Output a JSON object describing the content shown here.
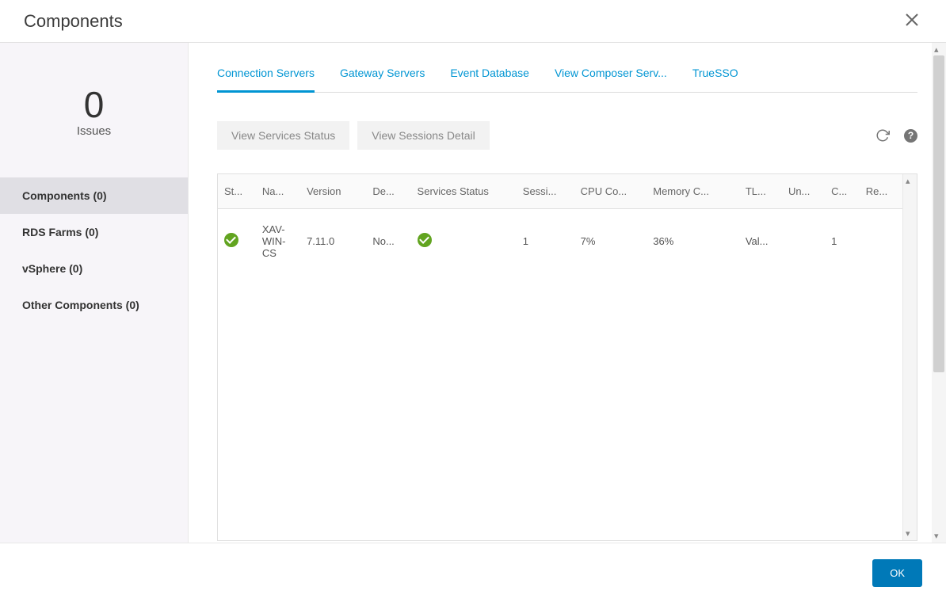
{
  "header": {
    "title": "Components"
  },
  "sidebar": {
    "issues_count": "0",
    "issues_label": "Issues",
    "items": [
      {
        "label": "Components (0)",
        "active": true
      },
      {
        "label": "RDS Farms (0)",
        "active": false
      },
      {
        "label": "vSphere (0)",
        "active": false
      },
      {
        "label": "Other Components (0)",
        "active": false
      }
    ]
  },
  "tabs": [
    {
      "label": "Connection Servers",
      "active": true
    },
    {
      "label": "Gateway Servers",
      "active": false
    },
    {
      "label": "Event Database",
      "active": false
    },
    {
      "label": "View Composer Serv...",
      "active": false
    },
    {
      "label": "TrueSSO",
      "active": false
    }
  ],
  "actions": {
    "view_services_status": "View Services Status",
    "view_sessions_detail": "View Sessions Detail"
  },
  "table": {
    "headers": {
      "status": "St...",
      "name": "Na...",
      "version": "Version",
      "default": "De...",
      "services_status": "Services Status",
      "sessions": "Sessi...",
      "cpu": "CPU Co...",
      "memory": "Memory C...",
      "tls": "TL...",
      "unauth": "Un...",
      "connections": "C...",
      "replication": "Re..."
    },
    "rows": [
      {
        "status": "ok",
        "name": "XAV-WIN-CS",
        "version": "7.11.0",
        "default": "No...",
        "services_status": "ok",
        "sessions": "1",
        "cpu": "7%",
        "memory": "36%",
        "tls": "Val...",
        "unauth": "",
        "connections": "1",
        "replication": ""
      }
    ]
  },
  "footer": {
    "ok_label": "OK"
  }
}
